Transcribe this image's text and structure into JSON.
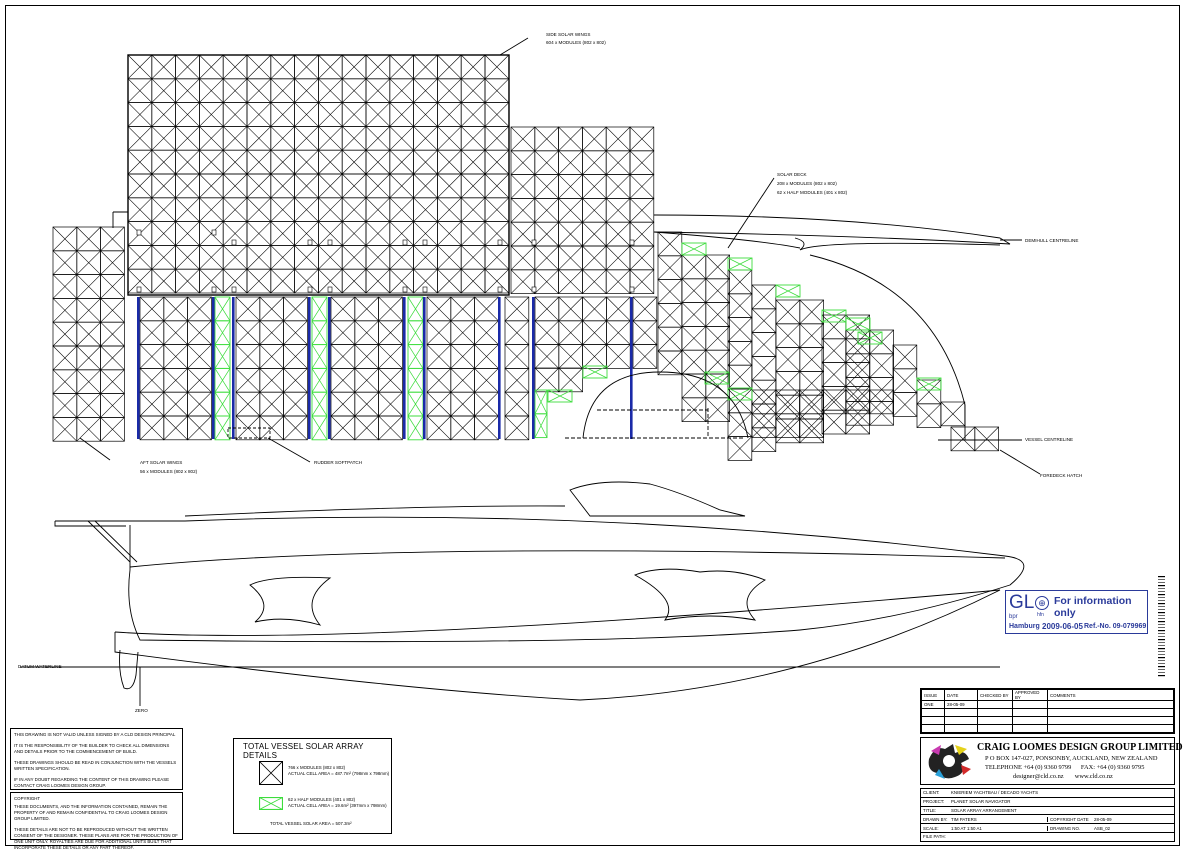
{
  "labels": {
    "side_wing_title": "SIDE SOLAR WINGS",
    "side_wing_detail": "604 x MODULES (802 x 802)",
    "solar_deck_title": "SOLAR DECK",
    "solar_deck_line1": "208 x MODULES (802 x 802)",
    "solar_deck_line2": "62 x HALF MODULES (401 x 802)",
    "demihull_centreline": "DEMIHULL CENTRELINE",
    "vessel_centreline": "VESSEL CENTRELINE",
    "foredeck_hatch": "FOREDECK HATCH",
    "aft_wing_title": "AFT SOLAR WINGS",
    "aft_wing_detail": "56 x MODULES (802 x 802)",
    "rudder_softpatch": "RUDDER SOFTPATCH",
    "datum_waterline": "DATUM WATERLINE",
    "zero": "ZERO"
  },
  "stamp": {
    "logo": "GL",
    "info": "For information only",
    "sub1": "bpr",
    "sub2": "hfn",
    "city": "Hamburg",
    "date": "2009-06-05",
    "ref": "Ref.-No. 09-079969"
  },
  "notes": {
    "p1": "THIS DRAWING IS NOT VALID UNLESS SIGNED BY A CLD DESIGN PRINCIPAL",
    "p2": "IT IS THE RESPONSIBILITY OF THE BUILDER TO CHECK ALL DIMENSIONS AND DETAILS PRIOR TO THE COMMENCEMENT OF BUILD.",
    "p3": "THESE DRAWINGS SHOULD BE READ IN CONJUNCTION WITH THE VESSELS WRITTEN SPECIFICATION.",
    "p4": "IF IN ANY DOUBT REGARDING THE CONTENT OF THIS DRAWING PLEASE CONTACT CRAIG LOOMES DESIGN GROUP.",
    "copyright_title": "COPYRIGHT",
    "c1": "THESE DOCUMENTS, AND THE INFORMATION CONTAINED, REMAIN THE PROPERTY OF AND REMAIN CONFIDENTIAL TO CRAIG LOOMES DESIGN GROUP LIMITED.",
    "c2": "THESE DETAILS ARE NOT TO BE REPRODUCED WITHOUT THE WRITTEN CONSENT OF THE DESIGNER. THESE PLANS ARE FOR THE PRODUCTION OF ONE UNIT ONLY. ROYALTIES ARE DUE FOR ADDITIONAL UNITS BUILT THAT INCORPORATE THESE DETAILS OR ANY PART THEREOF."
  },
  "legend": {
    "title": "TOTAL VESSEL SOLAR ARRAY DETAILS",
    "row1_a": "766 x MODULES (802 x 802)",
    "row1_b": "ACTUAL CELL AREA = 487.7m² (798mm x 798mm)",
    "row2_a": "62 x HALF MODULES (401 x 802)",
    "row2_b": "ACTUAL CELL AREA = 19.6m² (397mm x 798mm)",
    "total": "TOTAL VESSEL SOLAR AREA = 507.3m²"
  },
  "revisions": {
    "headers": [
      "ISSUE",
      "DATE",
      "CHECKED BY",
      "APPROVED BY",
      "COMMENTS"
    ],
    "rows": [
      [
        "ONE",
        "28-05-09",
        "",
        "",
        ""
      ]
    ]
  },
  "company": {
    "name": "CRAIG LOOMES DESIGN GROUP LIMITED",
    "address": "P O BOX 147-027, PONSONBY, AUCKLAND, NEW ZEALAND",
    "phone": "TELEPHONE +64 (0) 9360 9799      FAX: +64 (0) 9360 9795",
    "web": "designer@cld.co.nz       www.cld.co.nz"
  },
  "titleblock": {
    "client_k": "CLIENT:",
    "client_v": "KNIERIEM YACHTBAU / DECADO YACHTS",
    "project_k": "PROJECT:",
    "project_v": "PLANET SOLAR NAVIGATOR",
    "title_k": "TITLE:",
    "title_v": "SOLAR ARRAY ARRANGEMENT",
    "drawn_k": "DRAWN BY:",
    "drawn_v": "TIM PATERS",
    "cdate_k": "COPYRIGHT DATE",
    "cdate_v": "28-05-09",
    "scale_k": "SCALE:",
    "scale_v": "1:50 AT 1:50 A1",
    "dwg_k": "DRAWING NO.",
    "dwg_v": "ASB_02",
    "path_k": "FILE PATH:"
  },
  "colors": {
    "line": "#000000",
    "half_module": "#3ddc3d",
    "blue_strip": "#1a2aa8"
  }
}
